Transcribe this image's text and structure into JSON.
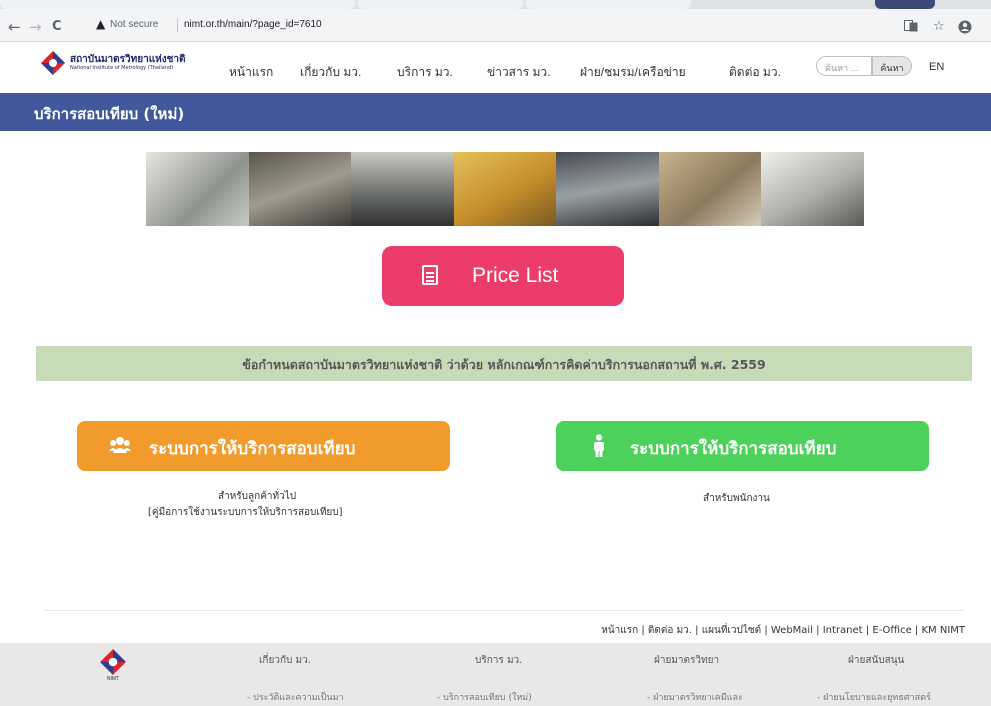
{
  "browser": {
    "security_label": "Not secure",
    "url": "nimt.or.th/main/?page_id=7610",
    "back_glyph": "←",
    "forward_glyph": "→",
    "reload_glyph": "C"
  },
  "site": {
    "logo_th": "สถาบันมาตรวิทยาแห่งชาติ",
    "logo_en": "National Institute of Metrology (Thailand)",
    "nav": [
      "หน้าแรก",
      "เกี่ยวกับ มว.",
      "บริการ มว.",
      "ข่าวสาร มว.",
      "ฝ่าย/ชมรม/เครือข่าย",
      "ติดต่อ มว."
    ],
    "search_placeholder": "ค้นหา ...",
    "search_button": "ค้นหา",
    "lang": "EN"
  },
  "page": {
    "title": "บริการสอบเทียบ (ใหม่)",
    "price_list_label": "Price List",
    "notice": "ข้อกำหนดสถาบันมาตรวิทยาแห่งชาติ ว่าด้วย หลักเกณฑ์การคิดค่าบริการนอกสถานที่ พ.ศ. 2559",
    "customer_button": "ระบบการให้บริการสอบเทียบ",
    "customer_sub1": "สำหรับลูกค้าทั่วไป",
    "customer_sub2": "[คู่มือการใช้งานระบบการให้บริการสอบเทียบ]",
    "staff_button": "ระบบการให้บริการสอบเทียบ",
    "staff_sub": "สำหรับพนักงาน"
  },
  "footer": {
    "links": [
      "หน้าแรก",
      "ติดต่อ มว.",
      "แผนที่เวปไซต์",
      "WebMail",
      "Intranet",
      "E-Office",
      "KM NIMT"
    ],
    "logo_text": "NIMT",
    "columns": [
      {
        "heading": "เกี่ยวกับ มว.",
        "first_item": "- ประวัติและความเป็นมา"
      },
      {
        "heading": "บริการ มว.",
        "first_item": "- บริการสอบเทียบ (ใหม่)"
      },
      {
        "heading": "ฝ่ายมาตรวิทยา",
        "first_item": "- ฝ่ายมาตรวิทยาเคมีและ"
      },
      {
        "heading": "ฝ่ายสนับสนุน",
        "first_item": "- ฝ่ายนโยบายและยุทธศาสตร์"
      }
    ]
  },
  "colors": {
    "title_bar": "#41589d",
    "price_button": "#ec3d6a",
    "notice_band": "#c6dcb8",
    "customer_button": "#f19b2c",
    "staff_button": "#4cd15a"
  }
}
